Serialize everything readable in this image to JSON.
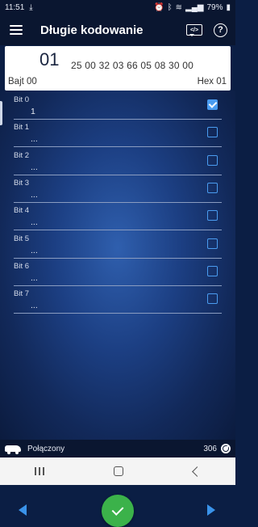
{
  "status_bar": {
    "time": "11:51",
    "download_glyph": "⤓",
    "battery": "79%",
    "right_icons": [
      "alarm-icon",
      "bluetooth-icon",
      "wifi-icon",
      "signal-icon",
      "battery-icon"
    ]
  },
  "app_bar": {
    "title": "Długie kodowanie",
    "code_icon_text": "</>",
    "help_icon_text": "?"
  },
  "byte_header": {
    "current_value": "01",
    "remaining_bytes": "25 00 32 03 66 05 08 30 00",
    "byte_label": "Bajt 00",
    "hex_label": "Hex 01"
  },
  "bits": [
    {
      "name": "Bit 0",
      "value": "1",
      "checked": true
    },
    {
      "name": "Bit 1",
      "value": "...",
      "checked": false
    },
    {
      "name": "Bit 2",
      "value": "...",
      "checked": false
    },
    {
      "name": "Bit 3",
      "value": "...",
      "checked": false
    },
    {
      "name": "Bit 4",
      "value": "...",
      "checked": false
    },
    {
      "name": "Bit 5",
      "value": "...",
      "checked": false
    },
    {
      "name": "Bit 6",
      "value": "...",
      "checked": false
    },
    {
      "name": "Bit 7",
      "value": "...",
      "checked": false
    }
  ],
  "footer": {
    "connection_status": "Połączony",
    "counter": "306"
  },
  "colors": {
    "accent_blue": "#3a93ea",
    "confirm_green": "#3bb24a",
    "app_bar_bg": "#0a1630"
  }
}
